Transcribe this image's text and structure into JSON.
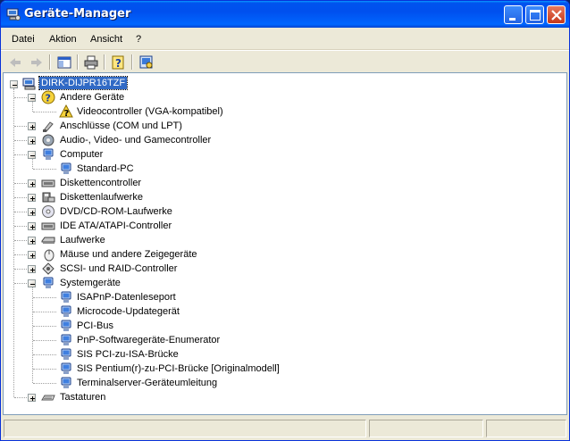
{
  "window": {
    "title": "Geräte-Manager"
  },
  "menu": [
    {
      "label": "Datei"
    },
    {
      "label": "Aktion"
    },
    {
      "label": "Ansicht"
    },
    {
      "label": "?"
    }
  ],
  "toolbar": {
    "buttons": [
      "back-arrow-icon",
      "forward-arrow-icon",
      "console-tree-icon",
      "print-icon",
      "help-icon",
      "scan-hardware-icon"
    ]
  },
  "tree": {
    "root": "DIRK-DIJPR16TZF",
    "nodes": [
      {
        "label": "Andere Geräte",
        "icon": "question-device-icon",
        "expanded": true
      },
      {
        "label": "Videocontroller (VGA-kompatibel)",
        "icon": "warning-device-icon"
      },
      {
        "label": "Anschlüsse (COM und LPT)",
        "icon": "port-icon",
        "expanded": false
      },
      {
        "label": "Audio-, Video- und Gamecontroller",
        "icon": "audio-icon",
        "expanded": false
      },
      {
        "label": "Computer",
        "icon": "computer-icon",
        "expanded": true
      },
      {
        "label": "Standard-PC",
        "icon": "computer-icon"
      },
      {
        "label": "Diskettencontroller",
        "icon": "controller-icon",
        "expanded": false
      },
      {
        "label": "Diskettenlaufwerke",
        "icon": "floppy-icon",
        "expanded": false
      },
      {
        "label": "DVD/CD-ROM-Laufwerke",
        "icon": "cdrom-icon",
        "expanded": false
      },
      {
        "label": "IDE ATA/ATAPI-Controller",
        "icon": "controller-icon",
        "expanded": false
      },
      {
        "label": "Laufwerke",
        "icon": "drive-icon",
        "expanded": false
      },
      {
        "label": "Mäuse und andere Zeigegeräte",
        "icon": "mouse-icon",
        "expanded": false
      },
      {
        "label": "SCSI- und RAID-Controller",
        "icon": "scsi-icon",
        "expanded": false
      },
      {
        "label": "Systemgeräte",
        "icon": "system-device-icon",
        "expanded": true
      },
      {
        "label": "ISAPnP-Datenleseport",
        "icon": "system-device-icon"
      },
      {
        "label": "Microcode-Updategerät",
        "icon": "system-device-icon"
      },
      {
        "label": "PCI-Bus",
        "icon": "system-device-icon"
      },
      {
        "label": "PnP-Softwaregeräte-Enumerator",
        "icon": "system-device-icon"
      },
      {
        "label": "SIS PCI-zu-ISA-Brücke",
        "icon": "system-device-icon"
      },
      {
        "label": "SIS Pentium(r)-zu-PCI-Brücke [Originalmodell]",
        "icon": "system-device-icon"
      },
      {
        "label": "Terminalserver-Geräteumleitung",
        "icon": "system-device-icon"
      },
      {
        "label": "Tastaturen",
        "icon": "keyboard-icon",
        "expanded": false
      }
    ]
  },
  "colors": {
    "titlebar": "#0054e3",
    "selection": "#316ac5",
    "chrome": "#ece9d8"
  }
}
